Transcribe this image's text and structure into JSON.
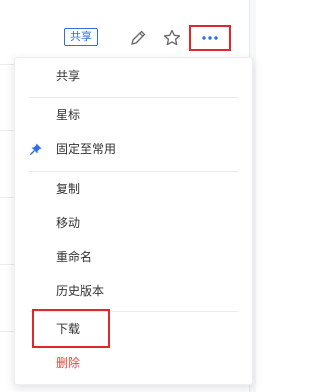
{
  "toolbar": {
    "share_tag": "共享",
    "edit_icon": "pencil-icon",
    "favorite_icon": "star-icon",
    "more_icon": "more-horizontal-icon"
  },
  "menu": {
    "items": [
      {
        "label": "共享"
      },
      {
        "label": "星标"
      },
      {
        "label": "固定至常用",
        "icon": "pin-icon"
      },
      {
        "label": "复制"
      },
      {
        "label": "移动"
      },
      {
        "label": "重命名"
      },
      {
        "label": "历史版本"
      },
      {
        "label": "下载"
      },
      {
        "label": "删除",
        "danger": true
      }
    ]
  },
  "colors": {
    "accent": "#2f6fe4",
    "danger": "#e24b3b",
    "annotation": "#e0272c"
  }
}
